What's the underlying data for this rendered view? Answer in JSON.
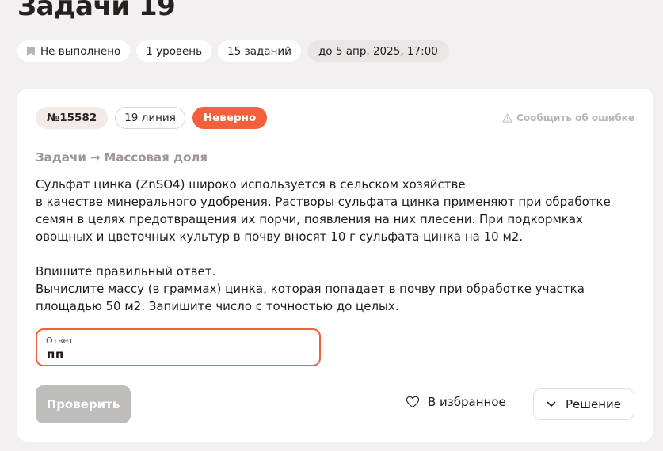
{
  "page": {
    "title": "Задачи 19"
  },
  "meta": {
    "status": "Не выполнено",
    "level": "1 уровень",
    "count": "15 заданий",
    "deadline": "до 5 апр. 2025, 17:00"
  },
  "task": {
    "id": "№15582",
    "line": "19 линия",
    "result": "Неверно",
    "report_label": "Сообщить об ошибке",
    "breadcrumb": {
      "section": "Задачи",
      "arrow": "→",
      "topic": "Массовая доля"
    },
    "text_lines": [
      "Сульфат цинка (ZnSO4) широко используется в сельском хозяйстве",
      "в качестве минерального удобрения. Растворы сульфата цинка применяют при обработке",
      "семян в целях предотвращения их порчи, появления на них плесени. При подкормках",
      "овощных и цветочных культур в почву вносят 10 г сульфата цинка на 10 м2."
    ],
    "question_lines": [
      "Впишите правильный ответ.",
      "Вычислите массу (в граммах) цинка, которая попадает в почву при обработке участка",
      "площадью 50 м2. Запишите число с точностью до целых."
    ]
  },
  "answer": {
    "label": "Ответ",
    "value": "пп"
  },
  "actions": {
    "check_label": "Проверить",
    "favorite_label": "В избранное",
    "solution_label": "Решение"
  },
  "colors": {
    "accent": "#f2603c",
    "background": "#f2f0f0",
    "disabled_button": "#bfbcbc"
  },
  "icons": {
    "status": "bookmark-icon",
    "report": "warning-icon",
    "favorite": "heart-icon",
    "solution": "chevron-down-icon"
  }
}
